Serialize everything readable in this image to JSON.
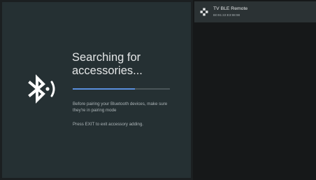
{
  "pairing": {
    "title_line1": "Searching for",
    "title_line2": "accessories...",
    "progress": 0.64,
    "description": "Before pairing your Bluetooth devices, make sure they're in pairing mode",
    "exit_hint": "Press EXIT to exit accessory adding.",
    "icon": "bluetooth-searching-icon"
  },
  "devices": [
    {
      "name": "TV BLE Remote",
      "address": "B0:91:22:E3:98:98",
      "icon": "gamepad-icon"
    }
  ],
  "colors": {
    "left_panel": "#253033",
    "right_panel": "#161819",
    "progress_fill": "#5a8fdd",
    "device_item": "#2b3234"
  }
}
